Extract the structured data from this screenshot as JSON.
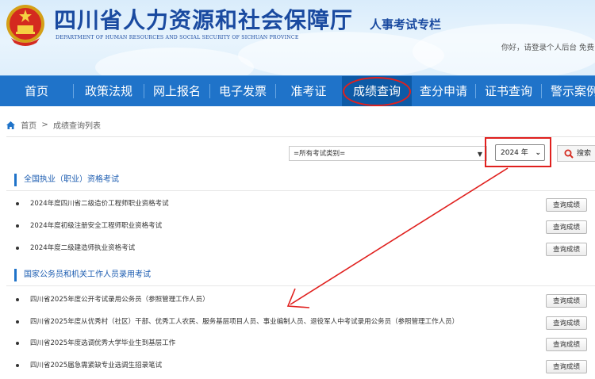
{
  "header": {
    "site_title": "四川省人力资源和社会保障厅",
    "site_subtitle": "DEPARTMENT OF HUMAN RESOURCES AND SOCIAL SECURITY OF SICHUAN PROVINCE",
    "column_title": "人事考试专栏",
    "user_links": "你好，请登录个人后台  免费"
  },
  "nav": {
    "items": [
      "首页",
      "政策法规",
      "网上报名",
      "电子发票",
      "准考证",
      "成绩查询",
      "查分申请",
      "证书查询",
      "警示案例"
    ],
    "active_label": "成绩查询"
  },
  "breadcrumb": {
    "home": "首页",
    "separator": ">",
    "current": "成绩查询列表"
  },
  "filters": {
    "exam_type": "=所有考试类别=",
    "year": "2024 年",
    "search_label": "搜索"
  },
  "sections": [
    {
      "title": "全国执业（职业）资格考试",
      "rows": [
        {
          "text": "2024年度四川省二级造价工程师职业资格考试",
          "button": "查询成绩"
        },
        {
          "text": "2024年度初级注册安全工程师职业资格考试",
          "button": "查询成绩"
        },
        {
          "text": "2024年度二级建造师执业资格考试",
          "button": "查询成绩"
        }
      ]
    },
    {
      "title": "国家公务员和机关工作人员录用考试",
      "rows": [
        {
          "text": "四川省2025年度公开考试录用公务员（参照管理工作人员）",
          "button": "查询成绩"
        },
        {
          "text": "四川省2025年度从优秀村（社区）干部、优秀工人农民、服务基层项目人员、事业编制人员、退役军人中考试录用公务员（参照管理工作人员）",
          "button": "查询成绩"
        },
        {
          "text": "四川省2025年度选调优秀大学毕业生到基层工作",
          "button": "查询成绩"
        },
        {
          "text": "四川省2025届急需紧缺专业选调生招录笔试",
          "button": "查询成绩"
        }
      ]
    }
  ],
  "colors": {
    "nav_bg": "#1f73c9",
    "nav_active": "#0d5aa6",
    "brand_blue": "#1a4aa0",
    "annotation_red": "#e0201e"
  },
  "icons": [
    "national-emblem-icon",
    "home-icon",
    "search-icon",
    "chevron-down-icon"
  ]
}
